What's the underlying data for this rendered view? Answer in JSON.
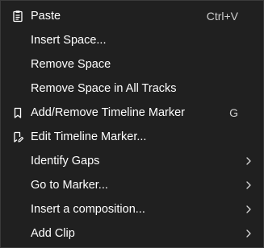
{
  "menu": {
    "items": [
      {
        "label": "Paste",
        "shortcut": "Ctrl+V",
        "icon": "clipboard-icon"
      },
      {
        "label": "Insert Space..."
      },
      {
        "label": "Remove Space"
      },
      {
        "label": "Remove Space in All Tracks"
      },
      {
        "label": "Add/Remove Timeline Marker",
        "shortcut": "G",
        "icon": "bookmark-icon"
      },
      {
        "label": "Edit Timeline Marker...",
        "icon": "bookmark-edit-icon"
      },
      {
        "label": "Identify Gaps",
        "submenu": true
      },
      {
        "label": "Go to Marker...",
        "submenu": true
      },
      {
        "label": "Insert a composition...",
        "submenu": true
      },
      {
        "label": "Add Clip",
        "submenu": true
      }
    ]
  },
  "colors": {
    "background": "#202020",
    "border": "#3a3a3a",
    "text": "#ffffff",
    "shortcut": "#cfcfcf"
  }
}
